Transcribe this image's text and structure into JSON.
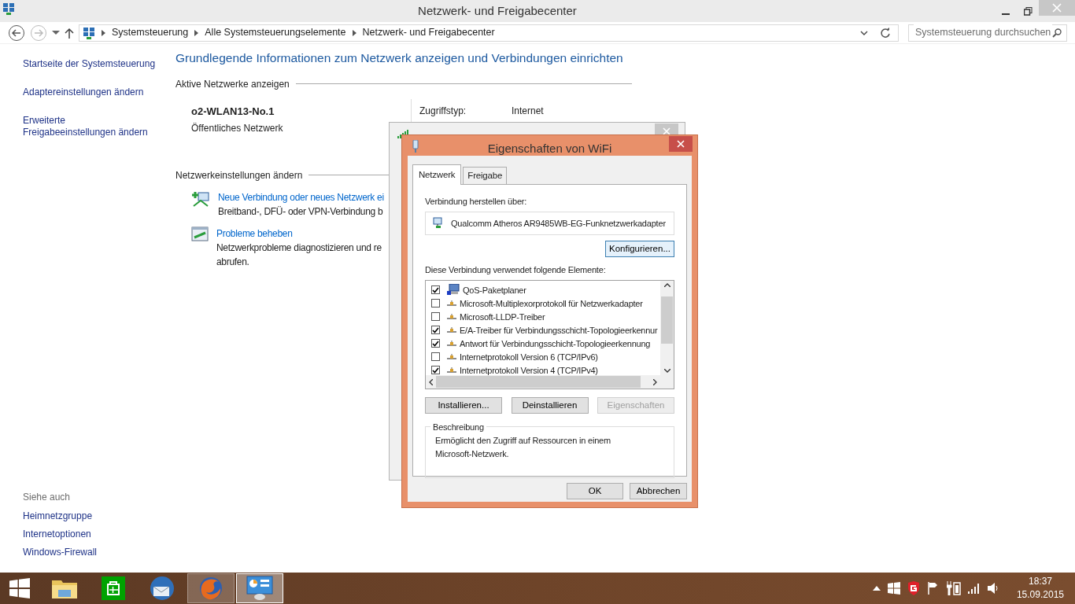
{
  "window": {
    "title": "Netzwerk- und Freigabecenter"
  },
  "address_bar": {
    "breadcrumb": [
      "Systemsteuerung",
      "Alle Systemsteuerungselemente",
      "Netzwerk- und Freigabecenter"
    ]
  },
  "search": {
    "placeholder": "Systemsteuerung durchsuchen"
  },
  "sidebar": {
    "links": [
      "Startseite der Systemsteuerung",
      "Adaptereinstellungen ändern",
      "Erweiterte Freigabeeinstellungen ändern"
    ],
    "see_also": {
      "title": "Siehe auch",
      "links": [
        "Heimnetzgruppe",
        "Internetoptionen",
        "Windows-Firewall"
      ]
    }
  },
  "main": {
    "heading": "Grundlegende Informationen zum Netzwerk anzeigen und Verbindungen einrichten",
    "active_networks": {
      "heading": "Aktive Netzwerke anzeigen",
      "name": "o2-WLAN13-No.1",
      "type": "Öffentliches Netzwerk",
      "details": [
        {
          "label": "Zugriffstyp:",
          "value": "Internet"
        }
      ]
    },
    "settings": {
      "heading": "Netzwerkeinstellungen ändern",
      "tasks": [
        {
          "kind": "new-connection",
          "title": "Neue Verbindung oder neues Netzwerk ei",
          "lines": [
            "Breitband-, DFÜ- oder VPN-Verbindung b"
          ]
        },
        {
          "kind": "troubleshoot",
          "title": "Probleme beheben",
          "lines": [
            "Netzwerkprobleme diagnostizieren und re",
            "abrufen."
          ]
        }
      ]
    }
  },
  "properties_dialog": {
    "title": "Eigenschaften von WiFi",
    "tabs": [
      {
        "label": "Netzwerk",
        "selected": true
      },
      {
        "label": "Freigabe",
        "selected": false
      }
    ],
    "connect_label": "Verbindung herstellen über:",
    "adapter": "Qualcomm Atheros AR9485WB-EG-Funknetzwerkadapter",
    "configure_button": "Konfigurieren...",
    "items_label": "Diese Verbindung verwendet folgende Elemente:",
    "items": [
      {
        "kind": "service",
        "label": "QoS-Paketplaner",
        "checked": true
      },
      {
        "kind": "protocol",
        "label": "Microsoft-Multiplexorprotokoll für Netzwerkadapter",
        "checked": false
      },
      {
        "kind": "protocol",
        "label": "Microsoft-LLDP-Treiber",
        "checked": false
      },
      {
        "kind": "protocol",
        "label": "E/A-Treiber für Verbindungsschicht-Topologieerkennur",
        "checked": true
      },
      {
        "kind": "protocol",
        "label": "Antwort für Verbindungsschicht-Topologieerkennung",
        "checked": true
      },
      {
        "kind": "protocol",
        "label": "Internetprotokoll Version 6 (TCP/IPv6)",
        "checked": false
      },
      {
        "kind": "protocol",
        "label": "Internetprotokoll Version 4 (TCP/IPv4)",
        "checked": true
      }
    ],
    "buttons": [
      {
        "label": "Installieren...",
        "disabled": false
      },
      {
        "label": "Deinstallieren",
        "disabled": false
      },
      {
        "label": "Eigenschaften",
        "disabled": true
      }
    ],
    "description": {
      "title": "Beschreibung",
      "text": "Ermöglicht den Zugriff auf Ressourcen in einem Microsoft-Netzwerk."
    },
    "footer_buttons": [
      "OK",
      "Abbrechen"
    ]
  },
  "taskbar": {
    "apps": [
      {
        "kind": "explorer",
        "running": false,
        "focused": false
      },
      {
        "kind": "store",
        "running": false,
        "focused": false
      },
      {
        "kind": "mail",
        "running": false,
        "focused": false
      },
      {
        "kind": "browser",
        "running": true,
        "focused": false
      },
      {
        "kind": "control-panel",
        "running": true,
        "focused": true
      }
    ],
    "time": "18:37",
    "date": "15.09.2015"
  }
}
